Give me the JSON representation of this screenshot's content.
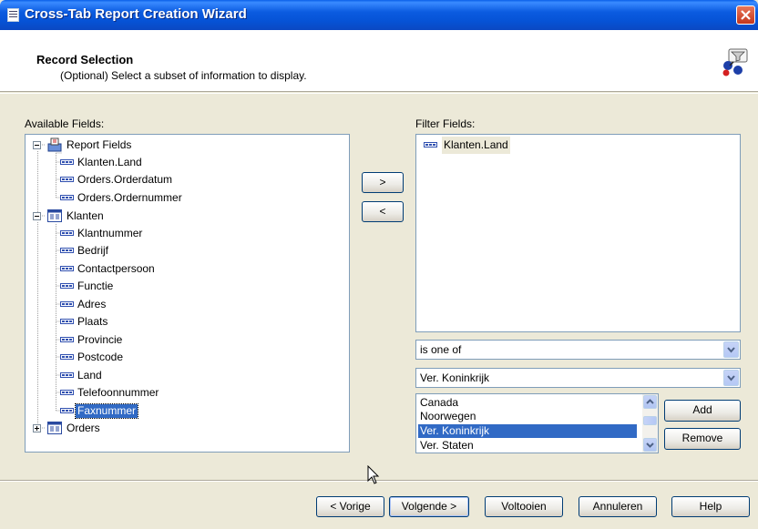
{
  "window": {
    "title": "Cross-Tab Report Creation Wizard",
    "close_icon": "close-icon"
  },
  "header": {
    "title": "Record Selection",
    "subtitle": "(Optional)  Select a subset of information to display."
  },
  "available": {
    "label": "Available Fields:",
    "groups": [
      {
        "label": "Report Fields",
        "items": [
          "Klanten.Land",
          "Orders.Orderdatum",
          "Orders.Ordernummer"
        ]
      },
      {
        "label": "Klanten",
        "items": [
          "Klantnummer",
          "Bedrijf",
          "Contactpersoon",
          "Functie",
          "Adres",
          "Plaats",
          "Provincie",
          "Postcode",
          "Land",
          "Telefoonnummer",
          "Faxnummer"
        ]
      },
      {
        "label": "Orders"
      }
    ]
  },
  "move": {
    "add": ">",
    "remove": "<"
  },
  "filter": {
    "label": "Filter Fields:",
    "items": [
      "Klanten.Land"
    ],
    "operator": "is one of",
    "value": "Ver. Koninkrijk",
    "options": [
      "Canada",
      "Noorwegen",
      "Ver. Koninkrijk",
      "Ver. Staten"
    ],
    "selected_option": "Ver. Koninkrijk",
    "add_label": "Add",
    "remove_label": "Remove"
  },
  "footer": {
    "back": "< Vorige",
    "next": "Volgende >",
    "finish": "Voltooien",
    "cancel": "Annuleren",
    "help": "Help"
  },
  "colors": {
    "titlebar": "#0a5fe8",
    "selection": "#316ac5",
    "dialog_bg": "#ece9d8"
  }
}
